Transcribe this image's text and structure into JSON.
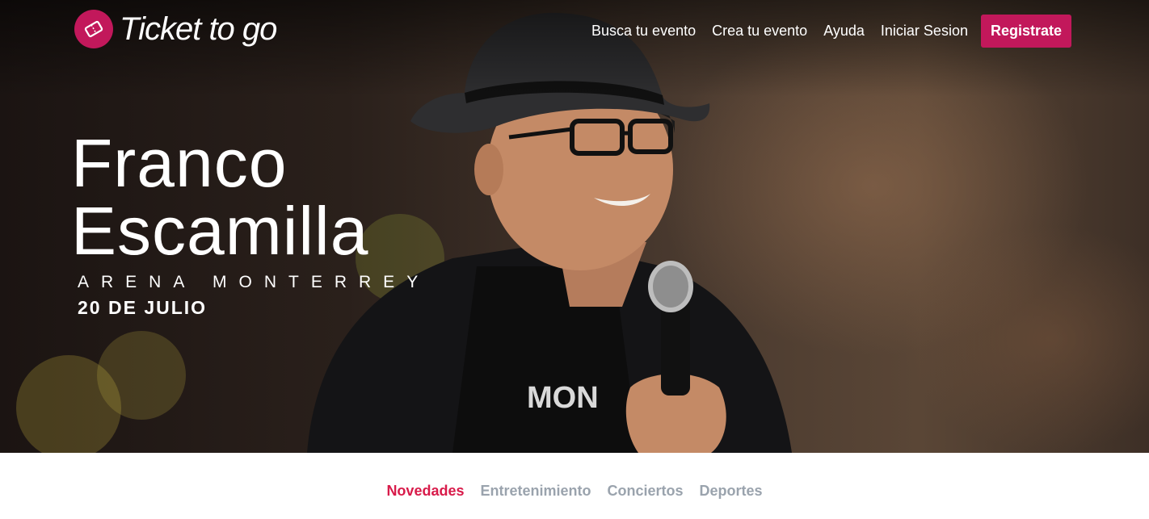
{
  "brand": {
    "name": "Ticket to go",
    "accent": "#c2185b"
  },
  "nav": {
    "items": [
      "Busca tu evento",
      "Crea tu evento",
      "Ayuda",
      "Iniciar Sesion"
    ],
    "register_label": "Registrate"
  },
  "hero": {
    "title_line1": "Franco",
    "title_line2": "Escamilla",
    "venue": "ARENA MONTERREY",
    "date": "20 DE JULIO"
  },
  "tabs": {
    "items": [
      "Novedades",
      "Entretenimiento",
      "Conciertos",
      "Deportes"
    ],
    "active": "Novedades",
    "active_color": "#d81b4a",
    "inactive_color": "#9aa3ad"
  }
}
